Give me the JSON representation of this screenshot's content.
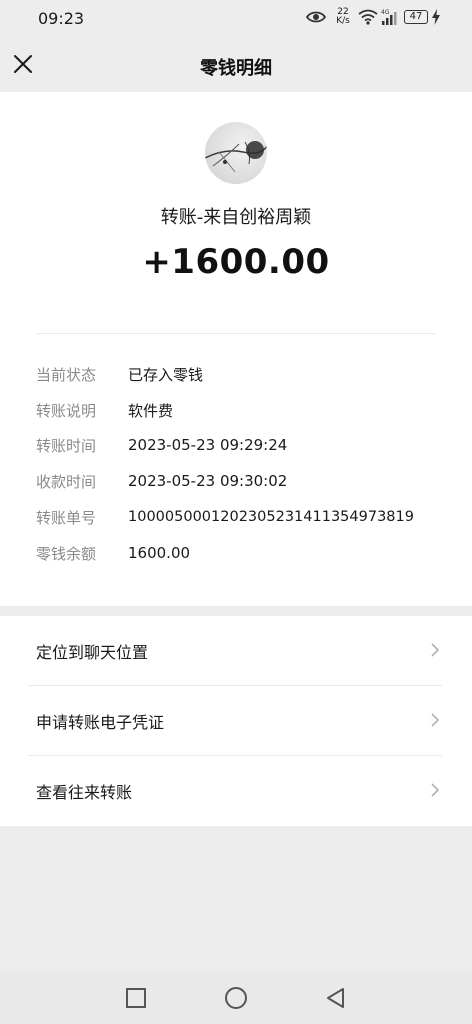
{
  "status_bar": {
    "time": "09:23",
    "net_speed_value": "22",
    "net_speed_unit": "K/s",
    "network_type": "4G",
    "battery": "47"
  },
  "header": {
    "title": "零钱明细",
    "close_icon": "close-icon"
  },
  "transaction": {
    "title": "转账-来自创裕周颖",
    "amount": "+1600.00",
    "details": [
      {
        "label": "当前状态",
        "value": "已存入零钱"
      },
      {
        "label": "转账说明",
        "value": "软件费"
      },
      {
        "label": "转账时间",
        "value": "2023-05-23 09:29:24"
      },
      {
        "label": "收款时间",
        "value": "2023-05-23 09:30:02"
      },
      {
        "label": "转账单号",
        "value": "1000050001202305231411354973819"
      },
      {
        "label": "零钱余额",
        "value": "1600.00"
      }
    ]
  },
  "actions": [
    {
      "label": "定位到聊天位置"
    },
    {
      "label": "申请转账电子凭证"
    },
    {
      "label": "查看往来转账"
    }
  ],
  "bottom_nav": {
    "icons": [
      "recent-apps-icon",
      "home-icon",
      "back-icon"
    ]
  }
}
